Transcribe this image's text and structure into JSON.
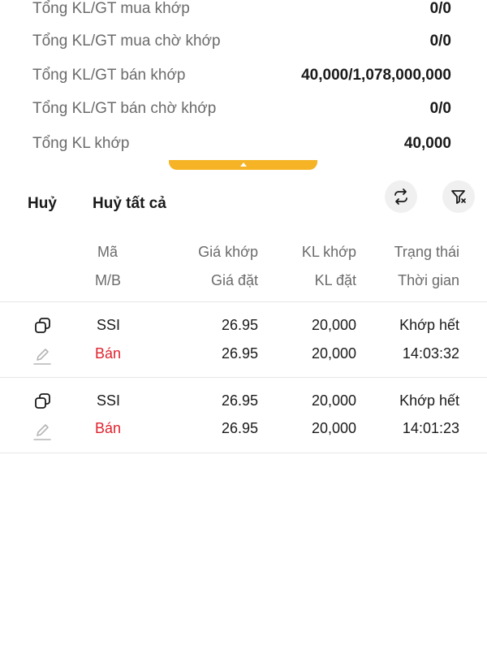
{
  "summary": {
    "rows": [
      {
        "label": "Tổng KL/GT mua khớp",
        "value": "0/0"
      },
      {
        "label": "Tổng KL/GT mua chờ khớp",
        "value": "0/0"
      },
      {
        "label": "Tổng KL/GT bán khớp",
        "value": "40,000/1,078,000,000"
      },
      {
        "label": "Tổng KL/GT bán chờ khớp",
        "value": "0/0"
      },
      {
        "label": "Tổng KL khớp",
        "value": "40,000"
      }
    ]
  },
  "actions": {
    "cancel_label": "Huỷ",
    "cancel_all_label": "Huỷ tất cả",
    "refresh_icon": "repeat-icon",
    "filter_icon": "filter-icon"
  },
  "table": {
    "headers": {
      "code": "Mã",
      "side": "M/B",
      "match_price": "Giá khớp",
      "order_price": "Giá đặt",
      "match_qty": "KL khớp",
      "order_qty": "KL đặt",
      "status": "Trạng thái",
      "time": "Thời gian"
    },
    "orders": [
      {
        "code": "SSI",
        "side": "Bán",
        "match_price": "26.95",
        "order_price": "26.95",
        "match_qty": "20,000",
        "order_qty": "20,000",
        "status": "Khớp hết",
        "time": "14:03:32"
      },
      {
        "code": "SSI",
        "side": "Bán",
        "match_price": "26.95",
        "order_price": "26.95",
        "match_qty": "20,000",
        "order_qty": "20,000",
        "status": "Khớp hết",
        "time": "14:01:23"
      }
    ]
  },
  "colors": {
    "accent": "#f5b325",
    "sell": "#e0232e"
  }
}
